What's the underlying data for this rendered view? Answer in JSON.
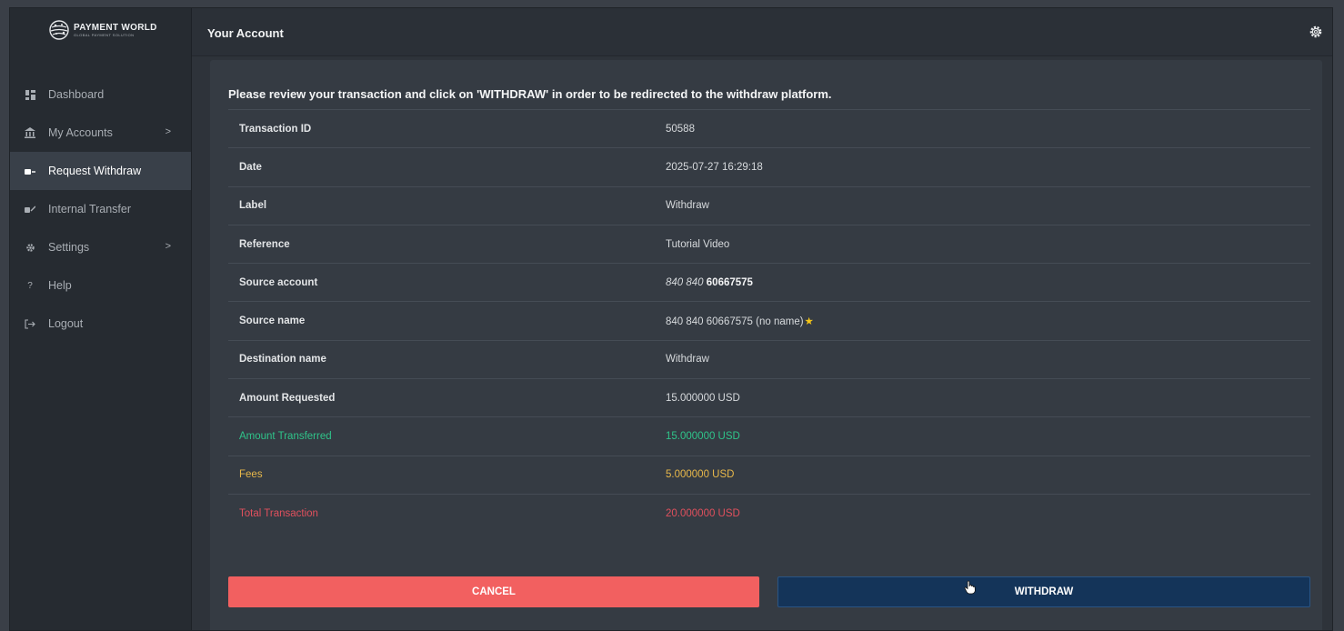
{
  "brand": {
    "title": "PAYMENT WORLD",
    "subtitle": "GLOBAL PAYMENT SOLUTION"
  },
  "sidebar": {
    "items": [
      {
        "label": "Dashboard",
        "icon": "dashboard-icon"
      },
      {
        "label": "My Accounts",
        "icon": "bank-icon",
        "has_chevron": true
      },
      {
        "label": "Request Withdraw",
        "icon": "withdraw-icon",
        "active": true
      },
      {
        "label": "Internal Transfer",
        "icon": "transfer-icon"
      },
      {
        "label": "Settings",
        "icon": "gear-icon",
        "has_chevron": true
      },
      {
        "label": "Help",
        "icon": "help-icon"
      },
      {
        "label": "Logout",
        "icon": "logout-icon"
      }
    ],
    "chevron": ">",
    "help_glyph": "?"
  },
  "header": {
    "title": "Your Account",
    "icon": "settings-gear-icon"
  },
  "main": {
    "heading": "Please review your transaction and click on 'WITHDRAW' in order to be redirected to the withdraw platform.",
    "rows": [
      {
        "label": "Transaction ID",
        "value": "50588"
      },
      {
        "label": "Date",
        "value": "2025-07-27 16:29:18"
      },
      {
        "label": "Label",
        "value": "Withdraw"
      },
      {
        "label": "Reference",
        "value": "Tutorial Video"
      },
      {
        "label": "Source account",
        "value_prefix": "840 840",
        "value_main": "60667575"
      },
      {
        "label": "Source name",
        "value": "840 840 60667575 (no name)",
        "suffix": "★"
      },
      {
        "label": "Destination name",
        "value": "Withdraw"
      },
      {
        "label": "Amount Requested",
        "value": "15.000000 USD"
      },
      {
        "label": "Amount Transferred",
        "value": "15.000000 USD",
        "color": "#2fc48a"
      },
      {
        "label": "Fees",
        "value": "5.000000 USD",
        "color": "#e8b84a"
      },
      {
        "label": "Total Transaction",
        "value": "20.000000 USD",
        "color": "#e0505d"
      }
    ],
    "cancel_label": "CANCEL",
    "withdraw_label": "WITHDRAW"
  },
  "colors": {
    "cancel": "#f26060",
    "withdraw": "#143459",
    "sidebar_active": "#394049"
  }
}
